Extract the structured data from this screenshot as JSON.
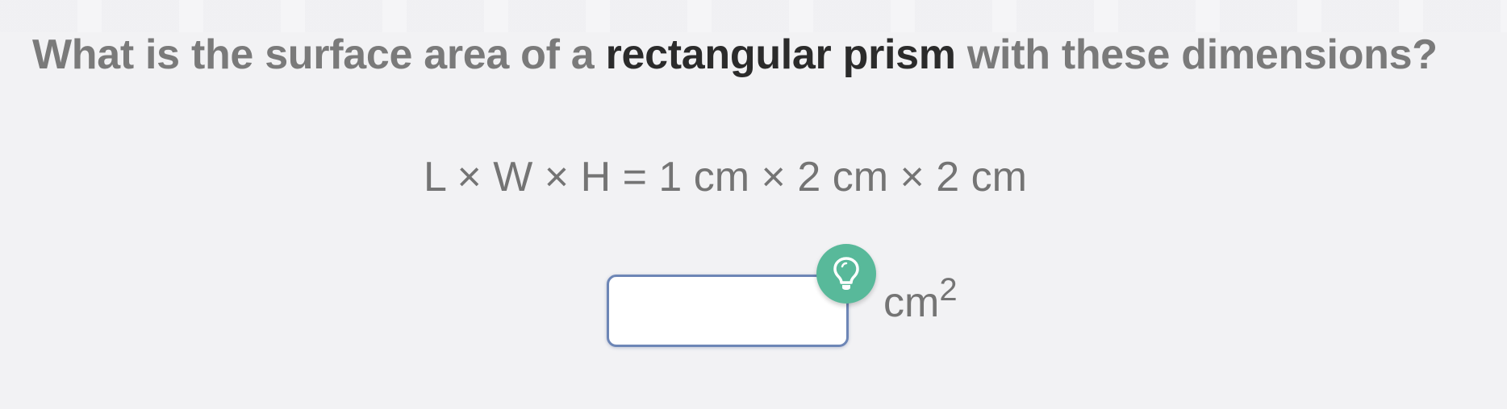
{
  "question": {
    "prefix": "What is the surface area of a ",
    "emphasis": "rectangular prism",
    "suffix": " with these dimensions?"
  },
  "formula": {
    "text": "L × W × H = 1 cm × 2 cm × 2 cm"
  },
  "answer": {
    "value": "",
    "placeholder": ""
  },
  "hint": {
    "icon": "lightbulb-icon",
    "color": "#58b99a"
  },
  "unit": {
    "base": "cm",
    "exponent": "2"
  }
}
